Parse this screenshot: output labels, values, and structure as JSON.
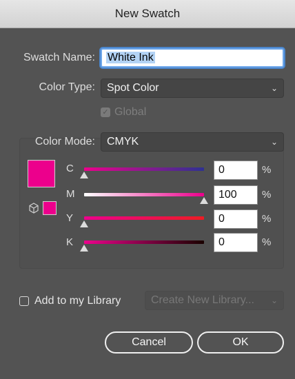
{
  "window": {
    "title": "New Swatch"
  },
  "swatch_name": {
    "label": "Swatch Name:",
    "value": "White Ink"
  },
  "color_type": {
    "label": "Color Type:",
    "selected": "Spot Color"
  },
  "global": {
    "label": "Global",
    "checked": true,
    "enabled": false
  },
  "color_mode": {
    "label": "Color Mode:",
    "selected": "CMYK"
  },
  "swatch_color": "#ec008c",
  "channels": [
    {
      "letter": "C",
      "value": "0",
      "unit": "%",
      "level": 0,
      "gradient": "linear-gradient(90deg, #ec008c, #2e3192)"
    },
    {
      "letter": "M",
      "value": "100",
      "unit": "%",
      "level": 100,
      "gradient": "linear-gradient(90deg, #ffffff, #ec008c)"
    },
    {
      "letter": "Y",
      "value": "0",
      "unit": "%",
      "level": 0,
      "gradient": "linear-gradient(90deg, #ec008c, #ed1c24)"
    },
    {
      "letter": "K",
      "value": "0",
      "unit": "%",
      "level": 0,
      "gradient": "linear-gradient(90deg, #ec008c, #1a0000)"
    }
  ],
  "library": {
    "label": "Add to my Library",
    "checked": false,
    "dropdown_value": "Create New Library..."
  },
  "buttons": {
    "cancel": "Cancel",
    "ok": "OK"
  }
}
